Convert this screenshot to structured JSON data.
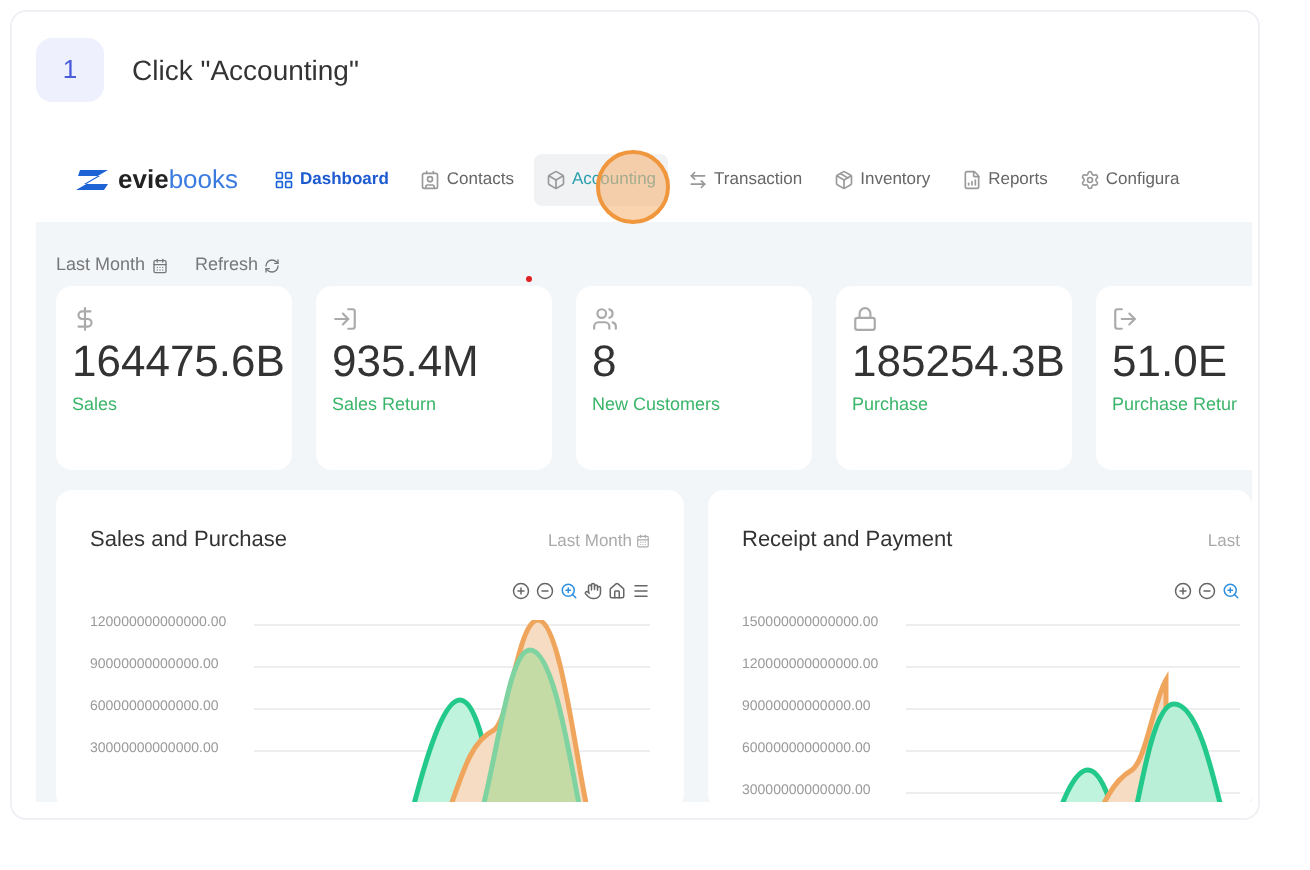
{
  "step": {
    "number": "1",
    "instruction": "Click \"Accounting\""
  },
  "app": {
    "logo": {
      "part_1": "evie",
      "part_2": "books"
    },
    "nav": [
      {
        "label": "Dashboard",
        "selected": true,
        "hovered": false
      },
      {
        "label": "Contacts",
        "selected": false,
        "hovered": false
      },
      {
        "label": "Accounting",
        "selected": false,
        "hovered": true
      },
      {
        "label": "Transaction",
        "selected": false,
        "hovered": false
      },
      {
        "label": "Inventory",
        "selected": false,
        "hovered": false
      },
      {
        "label": "Reports",
        "selected": false,
        "hovered": false
      },
      {
        "label": "Configura",
        "selected": false,
        "hovered": false
      }
    ],
    "filters": [
      {
        "label": "Last Month",
        "kind": "dropdown"
      },
      {
        "label": "Refresh",
        "kind": "refresh"
      }
    ],
    "stats": [
      {
        "value": "164475.6B",
        "label": "Sales",
        "kind": "sales"
      },
      {
        "value": "935.4M",
        "label": "Sales Return",
        "kind": "return"
      },
      {
        "value": "8",
        "label": "New Customers",
        "kind": "customers"
      },
      {
        "value": "185254.3B",
        "label": "Purchase",
        "kind": "purchase"
      },
      {
        "value": "51.0E",
        "label": "Purchase Retur",
        "kind": "purchase_return"
      }
    ],
    "panels": [
      {
        "title": "Sales and Purchase",
        "period": "Last Month",
        "yticks": [
          "120000000000000.00",
          "90000000000000.00",
          "60000000000000.00",
          "30000000000000.00"
        ],
        "kind": "sales"
      },
      {
        "title": "Receipt and Payment",
        "period": "Last",
        "yticks": [
          "150000000000000.00",
          "120000000000000.00",
          "90000000000000.00",
          "60000000000000.00",
          "30000000000000.00"
        ],
        "kind": "receipt"
      }
    ]
  }
}
